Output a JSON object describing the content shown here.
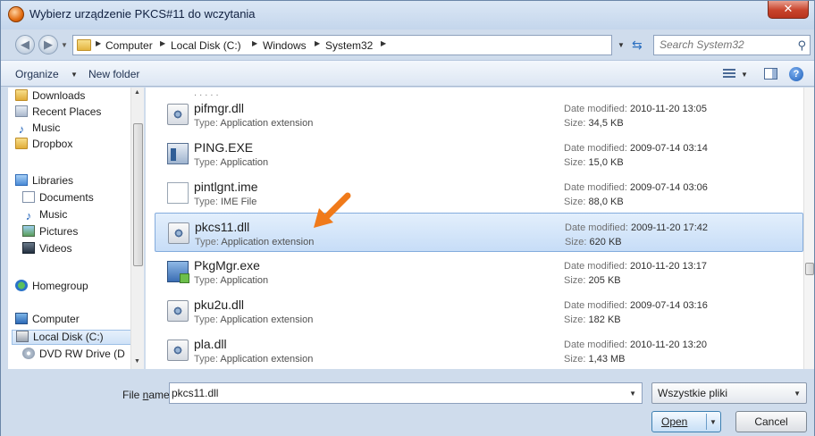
{
  "window": {
    "title": "Wybierz urządzenie PKCS#11 do wczytania",
    "close_label": "✕"
  },
  "address": {
    "breadcrumbs": [
      "Computer",
      "Local Disk (C:)",
      "Windows",
      "System32"
    ]
  },
  "search": {
    "placeholder": "Search System32"
  },
  "toolbar": {
    "organize_label": "Organize",
    "new_folder_label": "New folder"
  },
  "sidebar": {
    "items": [
      {
        "label": "Downloads",
        "icon": "folder-icon"
      },
      {
        "label": "Recent Places",
        "icon": "recent-places-icon"
      },
      {
        "label": "Music",
        "icon": "music-icon"
      },
      {
        "label": "Dropbox",
        "icon": "folder-icon"
      },
      {
        "label": "Libraries",
        "icon": "libraries-icon"
      },
      {
        "label": "Documents",
        "icon": "documents-icon"
      },
      {
        "label": "Music",
        "icon": "music-icon"
      },
      {
        "label": "Pictures",
        "icon": "pictures-icon"
      },
      {
        "label": "Videos",
        "icon": "videos-icon"
      },
      {
        "label": "Homegroup",
        "icon": "homegroup-icon"
      },
      {
        "label": "Computer",
        "icon": "computer-icon"
      },
      {
        "label": "Local Disk (C:)",
        "icon": "disk-icon"
      },
      {
        "label": "DVD RW Drive (D",
        "icon": "dvd-icon"
      }
    ]
  },
  "files": {
    "type_prefix": "Type:",
    "date_prefix": "Date modified:",
    "size_prefix": "Size:",
    "rows": [
      {
        "name": "pifmgr.dll",
        "type": "Application extension",
        "date": "2010-11-20 13:05",
        "size": "34,5 KB",
        "icon": "dll-icon",
        "selected": false
      },
      {
        "name": "PING.EXE",
        "type": "Application",
        "date": "2009-07-14 03:14",
        "size": "15,0 KB",
        "icon": "exe-icon",
        "selected": false
      },
      {
        "name": "pintlgnt.ime",
        "type": "IME File",
        "date": "2009-07-14 03:06",
        "size": "88,0 KB",
        "icon": "ime-file-icon",
        "selected": false
      },
      {
        "name": "pkcs11.dll",
        "type": "Application extension",
        "date": "2009-11-20 17:42",
        "size": "620 KB",
        "icon": "dll-icon",
        "selected": true
      },
      {
        "name": "PkgMgr.exe",
        "type": "Application",
        "date": "2010-11-20 13:17",
        "size": "205 KB",
        "icon": "package-manager-icon",
        "selected": false
      },
      {
        "name": "pku2u.dll",
        "type": "Application extension",
        "date": "2009-07-14 03:16",
        "size": "182 KB",
        "icon": "dll-icon",
        "selected": false
      },
      {
        "name": "pla.dll",
        "type": "Application extension",
        "date": "2010-11-20 13:20",
        "size": "1,43 MB",
        "icon": "dll-icon",
        "selected": false
      }
    ]
  },
  "footer": {
    "file_name_label_pre": "File ",
    "file_name_label_mnemonic": "n",
    "file_name_label_post": "ame:",
    "file_name_value": "pkcs11.dll",
    "filter_value": "Wszystkie pliki",
    "open_label": "Open",
    "cancel_label": "Cancel"
  },
  "colors": {
    "selection": "#c7ddf7",
    "annotation_arrow": "#f07a1a",
    "window_frame": "#cfdcec"
  }
}
